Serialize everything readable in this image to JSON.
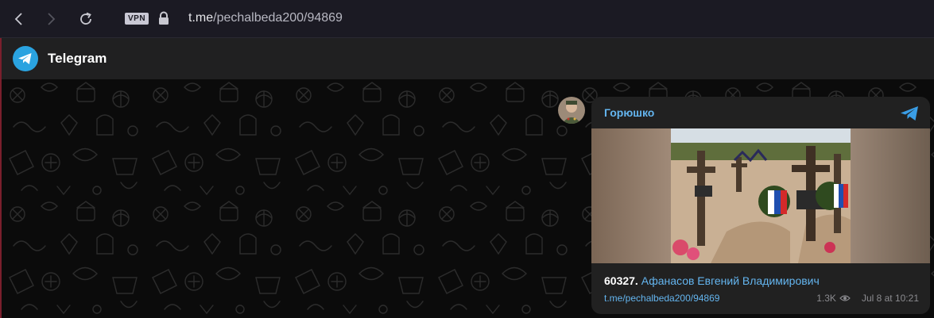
{
  "browser": {
    "vpn_label": "VPN",
    "url_host": "t.me",
    "url_path": "/pechalbeda200/94869"
  },
  "header": {
    "title": "Telegram"
  },
  "message": {
    "channel": "Горюшко",
    "number": "60327.",
    "text_link": "Афанасов Евгений Владимирович",
    "post_link": "t.me/pechalbeda200/94869",
    "views": "1.3K",
    "date": "Jul 8 at 10:21"
  },
  "colors": {
    "accent": "#64b5ef",
    "telegram_blue": "#2aa3e0"
  }
}
